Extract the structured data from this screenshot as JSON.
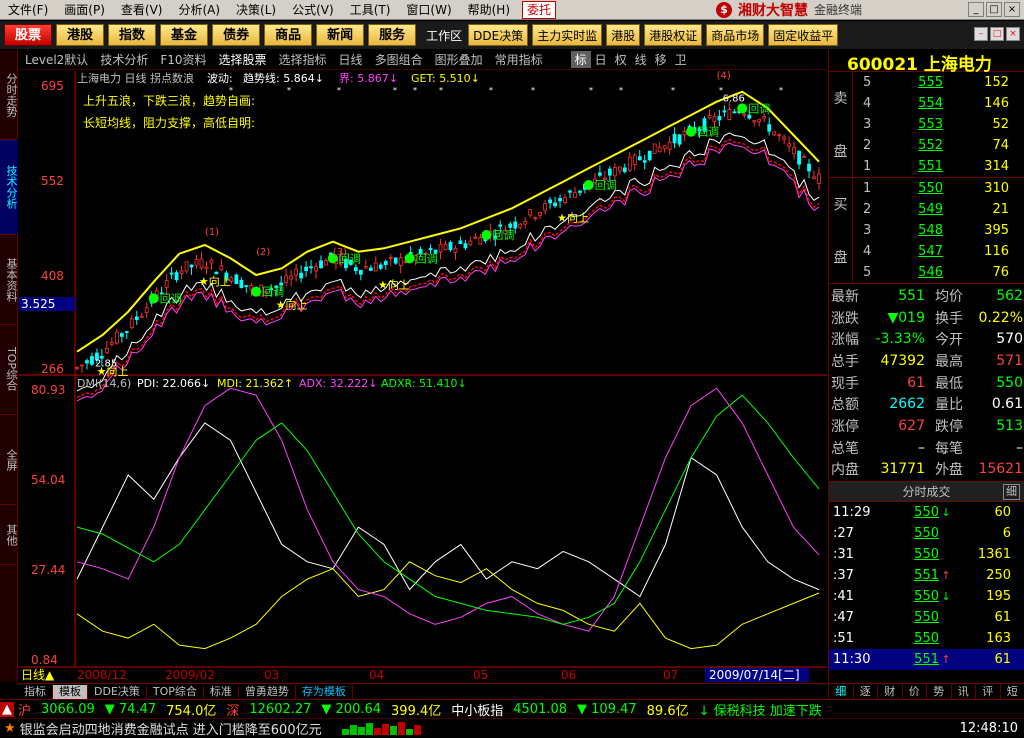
{
  "menu": {
    "items": [
      "文件(F)",
      "画面(P)",
      "查看(V)",
      "分析(A)",
      "决策(L)",
      "公式(V)",
      "工具(T)",
      "窗口(W)",
      "帮助(H)"
    ],
    "trade_label": "委托",
    "brand": "湘财大智慧",
    "brand_sub": "金融终端"
  },
  "toolbar": {
    "buttons": [
      "股票",
      "港股",
      "指数",
      "基金",
      "债券",
      "商品",
      "新闻",
      "服务"
    ],
    "workspace": "工作区",
    "links": [
      "DDE决策",
      "主力实时监",
      "港股",
      "港股权证",
      "商品市场",
      "固定收益平"
    ]
  },
  "sidetabs": [
    "分时走势",
    "技术分析",
    "基本资料",
    "TOP综合",
    "全屏",
    "其他"
  ],
  "chart_header": {
    "items": [
      "Level2默认",
      "技术分析",
      "F10资料",
      "选择股票",
      "选择指标",
      "日线",
      "多图组合",
      "图形叠加",
      "常用指标"
    ],
    "icons": [
      "标",
      "日",
      "权",
      "线",
      "移",
      "卫"
    ]
  },
  "chart_data": [
    {
      "type": "candlestick",
      "title": "上海电力 日线 拐点数浪",
      "indicator_text": [
        "波动:",
        "趋势线: 5.864↓",
        "界: 5.867↓",
        "GET: 5.510↓"
      ],
      "notes": [
        "上升五浪，下跌三浪，趋势自画:",
        "长短均线，阻力支撑，高低自明:"
      ],
      "yticks": [
        "695",
        "552",
        "408",
        "266"
      ],
      "current_price_label": "3.525",
      "low_label": "2.85",
      "peak_label": "6.86",
      "annotations": [
        "回调",
        "向上",
        "①",
        "②",
        "③",
        "(1)",
        "(2)",
        "(3)",
        "(4)",
        "III"
      ],
      "ylim": [
        2.66,
        6.95
      ],
      "trend_line": [
        2.95,
        3.2,
        3.55,
        4.0,
        4.42,
        4.55,
        4.35,
        4.1,
        4.2,
        4.45,
        4.6,
        4.45,
        4.5,
        4.6,
        4.7,
        4.8,
        4.95,
        5.1,
        5.3,
        5.5,
        5.7,
        5.9,
        6.1,
        6.3,
        6.5,
        6.7,
        6.85,
        6.6,
        6.2,
        5.8
      ]
    },
    {
      "type": "line",
      "title": "DMI(14,6)",
      "legend": [
        "PDI: 22.066↓",
        "MDI: 21.362↑",
        "ADX: 32.222↓",
        "ADXR: 51.410↓"
      ],
      "yticks": [
        "80.93",
        "54.04",
        "27.44",
        "0.84"
      ],
      "ylim": [
        0.84,
        80.93
      ],
      "x_labels": [
        "2008/12",
        "2009/02",
        "03",
        "04",
        "05",
        "06",
        "07"
      ],
      "cursor_date": "2009/07/14[二]",
      "series": [
        {
          "name": "PDI",
          "color": "#ffffff",
          "values": [
            25,
            40,
            55,
            48,
            60,
            70,
            65,
            50,
            35,
            30,
            28,
            40,
            35,
            22,
            30,
            35,
            25,
            30,
            28,
            33,
            30,
            25,
            20,
            35,
            60,
            55,
            40,
            30,
            25,
            22
          ]
        },
        {
          "name": "MDI",
          "color": "#ffff00",
          "values": [
            15,
            10,
            8,
            12,
            6,
            5,
            8,
            12,
            20,
            25,
            28,
            20,
            22,
            30,
            26,
            24,
            28,
            22,
            18,
            16,
            12,
            10,
            18,
            8,
            5,
            6,
            12,
            15,
            18,
            21
          ]
        },
        {
          "name": "ADX",
          "color": "#ff40ff",
          "values": [
            30,
            28,
            25,
            40,
            60,
            75,
            80,
            78,
            65,
            45,
            30,
            22,
            20,
            15,
            12,
            14,
            18,
            20,
            15,
            12,
            10,
            20,
            40,
            60,
            75,
            80,
            70,
            55,
            40,
            32
          ]
        },
        {
          "name": "ADXR",
          "color": "#00ff00",
          "values": [
            40,
            38,
            34,
            30,
            35,
            45,
            55,
            65,
            70,
            62,
            50,
            38,
            30,
            25,
            20,
            18,
            16,
            15,
            14,
            12,
            14,
            18,
            30,
            45,
            60,
            72,
            78,
            70,
            60,
            51
          ]
        }
      ]
    }
  ],
  "bottom_tabs": [
    "指标",
    "模板",
    "DDE决策",
    "TOP综合",
    "标准",
    "曾勇趋势",
    "存为模板"
  ],
  "quote": {
    "code": "600021",
    "name": "上海电力",
    "ask_label": [
      "卖",
      "盘"
    ],
    "bid_label": [
      "买",
      "盘"
    ],
    "asks": [
      {
        "lv": "5",
        "px": "555",
        "qty": "152"
      },
      {
        "lv": "4",
        "px": "554",
        "qty": "146"
      },
      {
        "lv": "3",
        "px": "553",
        "qty": "52"
      },
      {
        "lv": "2",
        "px": "552",
        "qty": "74"
      },
      {
        "lv": "1",
        "px": "551",
        "qty": "314"
      }
    ],
    "bids": [
      {
        "lv": "1",
        "px": "550",
        "qty": "310"
      },
      {
        "lv": "2",
        "px": "549",
        "qty": "21"
      },
      {
        "lv": "3",
        "px": "548",
        "qty": "395"
      },
      {
        "lv": "4",
        "px": "547",
        "qty": "116"
      },
      {
        "lv": "5",
        "px": "546",
        "qty": "76"
      }
    ],
    "stats": [
      {
        "l1": "最新",
        "v1": "551",
        "c1": "g",
        "l2": "均价",
        "v2": "562",
        "c2": "g"
      },
      {
        "l1": "涨跌",
        "v1": "▼019",
        "c1": "g",
        "l2": "换手",
        "v2": "0.22%",
        "c2": "y"
      },
      {
        "l1": "涨幅",
        "v1": "-3.33%",
        "c1": "g",
        "l2": "今开",
        "v2": "570",
        "c2": "w"
      },
      {
        "l1": "总手",
        "v1": "47392",
        "c1": "y",
        "l2": "最高",
        "v2": "571",
        "c2": "r"
      },
      {
        "l1": "现手",
        "v1": "61",
        "c1": "r",
        "l2": "最低",
        "v2": "550",
        "c2": "g"
      },
      {
        "l1": "总额",
        "v1": "2662",
        "c1": "c",
        "l2": "量比",
        "v2": "0.61",
        "c2": "w"
      },
      {
        "l1": "涨停",
        "v1": "627",
        "c1": "r",
        "l2": "跌停",
        "v2": "513",
        "c2": "g"
      },
      {
        "l1": "总笔",
        "v1": "–",
        "c1": "w",
        "l2": "每笔",
        "v2": "–",
        "c2": "w"
      },
      {
        "l1": "内盘",
        "v1": "31771",
        "c1": "y",
        "l2": "外盘",
        "v2": "15621",
        "c2": "r"
      }
    ],
    "trades_title": "分时成交",
    "trades_detail": "细",
    "trades": [
      {
        "t": "11:29",
        "p": "550",
        "a": "↓",
        "ac": "g",
        "v": "60",
        "vc": "r",
        "hl": false
      },
      {
        "t": ":27",
        "p": "550",
        "a": "",
        "ac": "w",
        "v": "6",
        "vc": "r",
        "hl": false
      },
      {
        "t": ":31",
        "p": "550",
        "a": "",
        "ac": "w",
        "v": "1361",
        "vc": "r",
        "hl": false
      },
      {
        "t": ":37",
        "p": "551",
        "a": "↑",
        "ac": "r",
        "v": "250",
        "vc": "r",
        "hl": false
      },
      {
        "t": ":41",
        "p": "550",
        "a": "↓",
        "ac": "g",
        "v": "195",
        "vc": "r",
        "hl": false
      },
      {
        "t": ":47",
        "p": "550",
        "a": "",
        "ac": "w",
        "v": "61",
        "vc": "r",
        "hl": false
      },
      {
        "t": ":51",
        "p": "550",
        "a": "",
        "ac": "w",
        "v": "163",
        "vc": "r",
        "hl": false
      },
      {
        "t": "11:30",
        "p": "551",
        "a": "↑",
        "ac": "r",
        "v": "61",
        "vc": "y",
        "hl": true
      }
    ],
    "rtabs": [
      "细",
      "逐",
      "财",
      "价",
      "势",
      "讯",
      "评",
      "短"
    ]
  },
  "status": {
    "sh_label": "沪",
    "sh_index": "3066.09",
    "sh_change": "▼ 74.47",
    "sh_amount": "754.0亿",
    "sz_label": "深",
    "sz_index": "12602.27",
    "sz_change": "▼ 200.64",
    "sz_amount": "399.4亿",
    "sme_label": "中小板指",
    "sme_index": "4501.08",
    "sme_change": "▼ 109.47",
    "sme_amount": "89.6亿",
    "alert": "↓ 保税科技 加速下跌"
  },
  "ticker": {
    "news": "银监会启动四地消费金融试点 进入门槛降至600亿元",
    "time": "12:48:10"
  }
}
